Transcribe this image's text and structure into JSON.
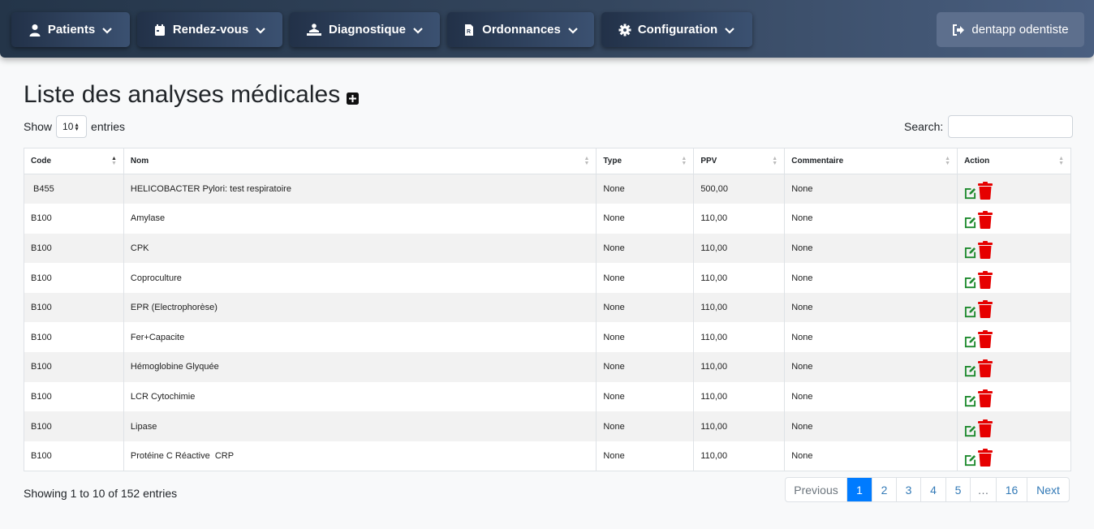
{
  "nav": {
    "items": [
      {
        "label": "Patients",
        "icon": "user-icon"
      },
      {
        "label": "Rendez-vous",
        "icon": "calendar-icon"
      },
      {
        "label": "Diagnostique",
        "icon": "medical-exam-icon"
      },
      {
        "label": "Ordonnances",
        "icon": "prescription-icon"
      },
      {
        "label": "Configuration",
        "icon": "gear-icon"
      }
    ],
    "logout_label": "dentapp odentiste"
  },
  "page": {
    "title": "Liste des analyses médicales"
  },
  "length": {
    "show_label": "Show",
    "value": "10",
    "entries_label": "entries"
  },
  "search": {
    "label": "Search:",
    "value": ""
  },
  "table": {
    "headers": [
      "Code",
      "Nom",
      "Type",
      "PPV",
      "Commentaire",
      "Action"
    ],
    "rows": [
      [
        " B455",
        "HELICOBACTER Pylori: test respiratoire",
        "None",
        "500,00",
        "None"
      ],
      [
        "B100",
        "Amylase",
        "None",
        "110,00",
        "None"
      ],
      [
        "B100",
        "CPK",
        "None",
        "110,00",
        "None"
      ],
      [
        "B100",
        "Coproculture",
        "None",
        "110,00",
        "None"
      ],
      [
        "B100",
        "EPR (Electrophorèse)",
        "None",
        "110,00",
        "None"
      ],
      [
        "B100",
        "Fer+Capacite",
        "None",
        "110,00",
        "None"
      ],
      [
        "B100",
        "Hémoglobine Glyquée",
        "None",
        "110,00",
        "None"
      ],
      [
        "B100",
        "LCR Cytochimie",
        "None",
        "110,00",
        "None"
      ],
      [
        "B100",
        "Lipase",
        "None",
        "110,00",
        "None"
      ],
      [
        "B100",
        "Protéine C Réactive  CRP",
        "None",
        "110,00",
        "None"
      ]
    ]
  },
  "info": "Showing 1 to 10 of 152 entries",
  "pagination": {
    "previous": "Previous",
    "pages": [
      "1",
      "2",
      "3",
      "4",
      "5",
      "…",
      "16"
    ],
    "next": "Next",
    "active": "1"
  },
  "colors": {
    "edit": "#1e8a2e",
    "delete": "#e60000",
    "active_page": "#007bff"
  }
}
